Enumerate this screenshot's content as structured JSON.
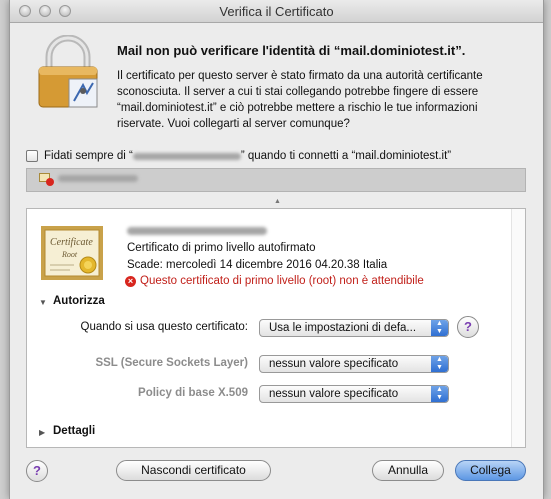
{
  "window": {
    "title": "Verifica il Certificato"
  },
  "alert": {
    "heading": "Mail non può verificare l'identità di “mail.dominiotest.it”.",
    "description": "Il certificato per questo server è stato firmato da una autorità certificante sconosciuta. Il server a cui ti stai collegando potrebbe fingere di essere “mail.dominiotest.it” e ciò potrebbe mettere a rischio le tue informazioni riservate. Vuoi collegarti al server comunque?"
  },
  "trust_checkbox": {
    "label_before": "Fidati sempre di “",
    "label_after": "” quando ti connetti a “mail.dominiotest.it”",
    "checked": false
  },
  "certificate": {
    "image_title": "Certificate",
    "image_subtitle": "Root",
    "type": "Certificato di primo livello autofirmato",
    "expiry": "Scade: mercoledì 14 dicembre 2016 04.20.38 Italia",
    "warning": "Questo certificato di primo livello (root) non è attendibile"
  },
  "trust_section": {
    "title": "Autorizza",
    "when_using_label": "Quando si usa questo certificato:",
    "when_using_value": "Usa le impostazioni di defa...",
    "ssl_label": "SSL (Secure Sockets Layer)",
    "ssl_value": "nessun valore specificato",
    "x509_label": "Policy di base X.509",
    "x509_value": "nessun valore specificato",
    "help": "?"
  },
  "details_section": {
    "title": "Dettagli"
  },
  "buttons": {
    "help": "?",
    "hide_certificate": "Nascondi certificato",
    "cancel": "Annulla",
    "connect": "Collega"
  },
  "colors": {
    "warning": "#c1201a",
    "accent": "#5d97e4",
    "help_glyph": "#7a3fb1"
  }
}
